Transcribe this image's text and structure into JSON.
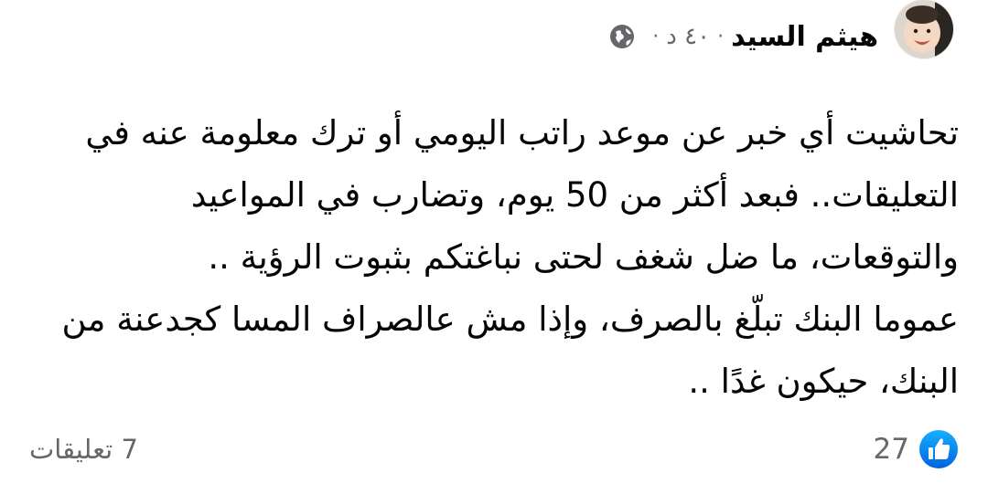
{
  "post": {
    "author_name": "هيثم السيد",
    "separator": "·",
    "time": "٤٠ د",
    "visibility_icon": "globe-icon",
    "avatar_icon": "avatar-photo",
    "text_lines": [
      "تحاشيت أي خبر عن موعد راتب اليومي أو ترك معلومة عنه في",
      "التعليقات.. فبعد أكثر من 50 يوم، وتضارب في المواعيد",
      "والتوقعات، ما ضل شغف لحتى نباغتكم بثبوت الرؤية ..",
      "عموما البنك تبلّغ بالصرف، وإذا مش عالصراف المسا كجدعنة من",
      "البنك، حيكون غدًا .."
    ]
  },
  "footer": {
    "like_icon": "like-reaction-icon",
    "reaction_count": "27",
    "comments_label": "7 تعليقات"
  },
  "colors": {
    "text": "#050505",
    "secondary": "#65676b",
    "like_blue": "#1877f2"
  }
}
